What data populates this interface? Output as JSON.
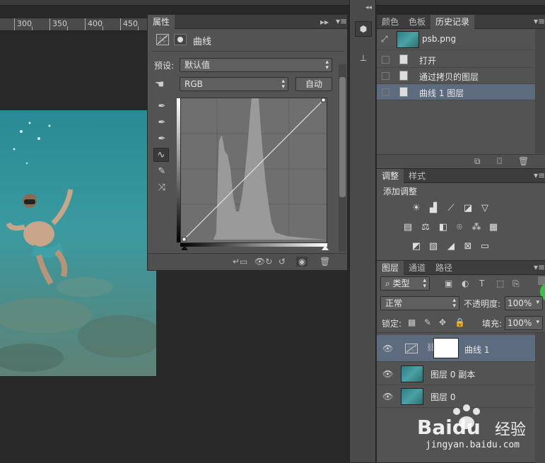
{
  "ruler": {
    "ticks": [
      "300",
      "350",
      "400",
      "450"
    ]
  },
  "properties": {
    "tab_label": "属性",
    "adjustment_name": "曲线",
    "preset_label": "预设:",
    "preset_value": "默认值",
    "channel_value": "RGB",
    "auto_button": "自动"
  },
  "history": {
    "tabs": [
      "颜色",
      "色板",
      "历史记录"
    ],
    "snapshot_name": "psb.png",
    "items": [
      "打开",
      "通过拷贝的图层",
      "曲线 1 图层"
    ]
  },
  "adjustments": {
    "tabs": [
      "调整",
      "样式"
    ],
    "add_label": "添加调整"
  },
  "layers": {
    "tabs": [
      "图层",
      "通道",
      "路径"
    ],
    "filter_value": "类型",
    "blend_mode": "正常",
    "opacity_label": "不透明度:",
    "opacity_value": "100%",
    "lock_label": "锁定:",
    "fill_label": "填充:",
    "fill_value": "100%",
    "items": [
      "曲线 1",
      "图层 0 副本",
      "图层 0"
    ]
  },
  "watermark": {
    "site": "jingyan.baidu.com",
    "brand": "Baidu",
    "brand_cn": "经验"
  },
  "colors": {
    "panel": "#535353",
    "selection": "#5d6b7f",
    "dark": "#282828"
  }
}
